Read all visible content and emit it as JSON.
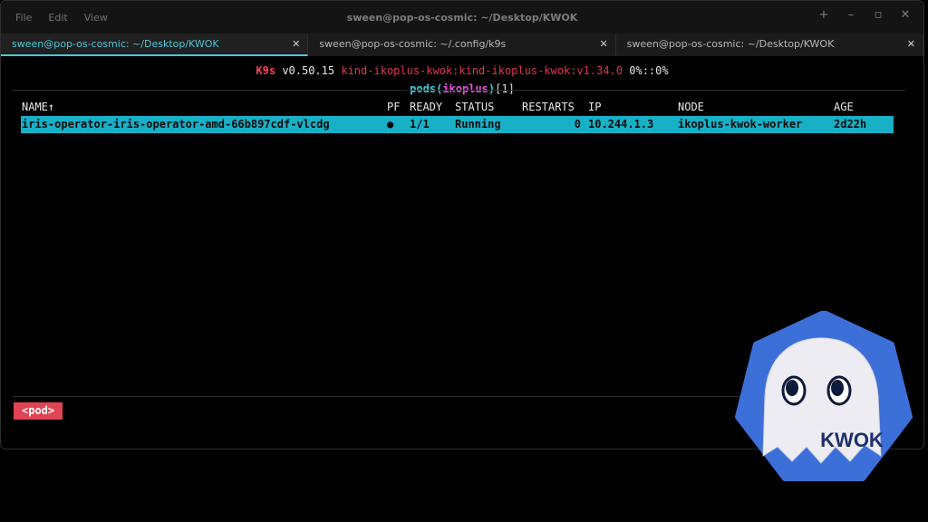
{
  "window": {
    "title": "sween@pop-os-cosmic: ~/Desktop/KWOK",
    "menu": [
      "File",
      "Edit",
      "View"
    ]
  },
  "tabs": [
    {
      "label": "sween@pop-os-cosmic: ~/Desktop/KWOK",
      "active": true
    },
    {
      "label": "sween@pop-os-cosmic: ~/.config/k9s",
      "active": false
    },
    {
      "label": "sween@pop-os-cosmic: ~/Desktop/KWOK",
      "active": false
    }
  ],
  "k9s": {
    "name": "K9s",
    "version": "v0.50.15",
    "context": "kind-ikoplus-kwok:kind-ikoplus-kwok:v1.34.0",
    "usage": "0%::0%"
  },
  "view": {
    "resource": "pods",
    "namespace": "ikoplus",
    "count": "[1]"
  },
  "table": {
    "columns": [
      "NAME↑",
      "PF",
      "READY",
      "STATUS",
      "RESTARTS",
      "IP",
      "NODE",
      "AGE"
    ],
    "rows": [
      {
        "name": "iris-operator-iris-operator-amd-66b897cdf-vlcdg",
        "pf": "●",
        "ready": "1/1",
        "status": "Running",
        "restarts": "0",
        "ip": "10.244.1.3",
        "node": "ikoplus-kwok-worker",
        "age": "2d22h"
      }
    ]
  },
  "breadcrumb": "<pod>",
  "logo": {
    "text": "KWOK",
    "body_color": "#3d6fd9"
  },
  "colors": {
    "accent": "#4cc6d9",
    "highlight_row": "#17b0c7",
    "k9s_red": "#ff3e5b",
    "namespace_magenta": "#f04fe8",
    "crumb_red": "#e04453"
  }
}
